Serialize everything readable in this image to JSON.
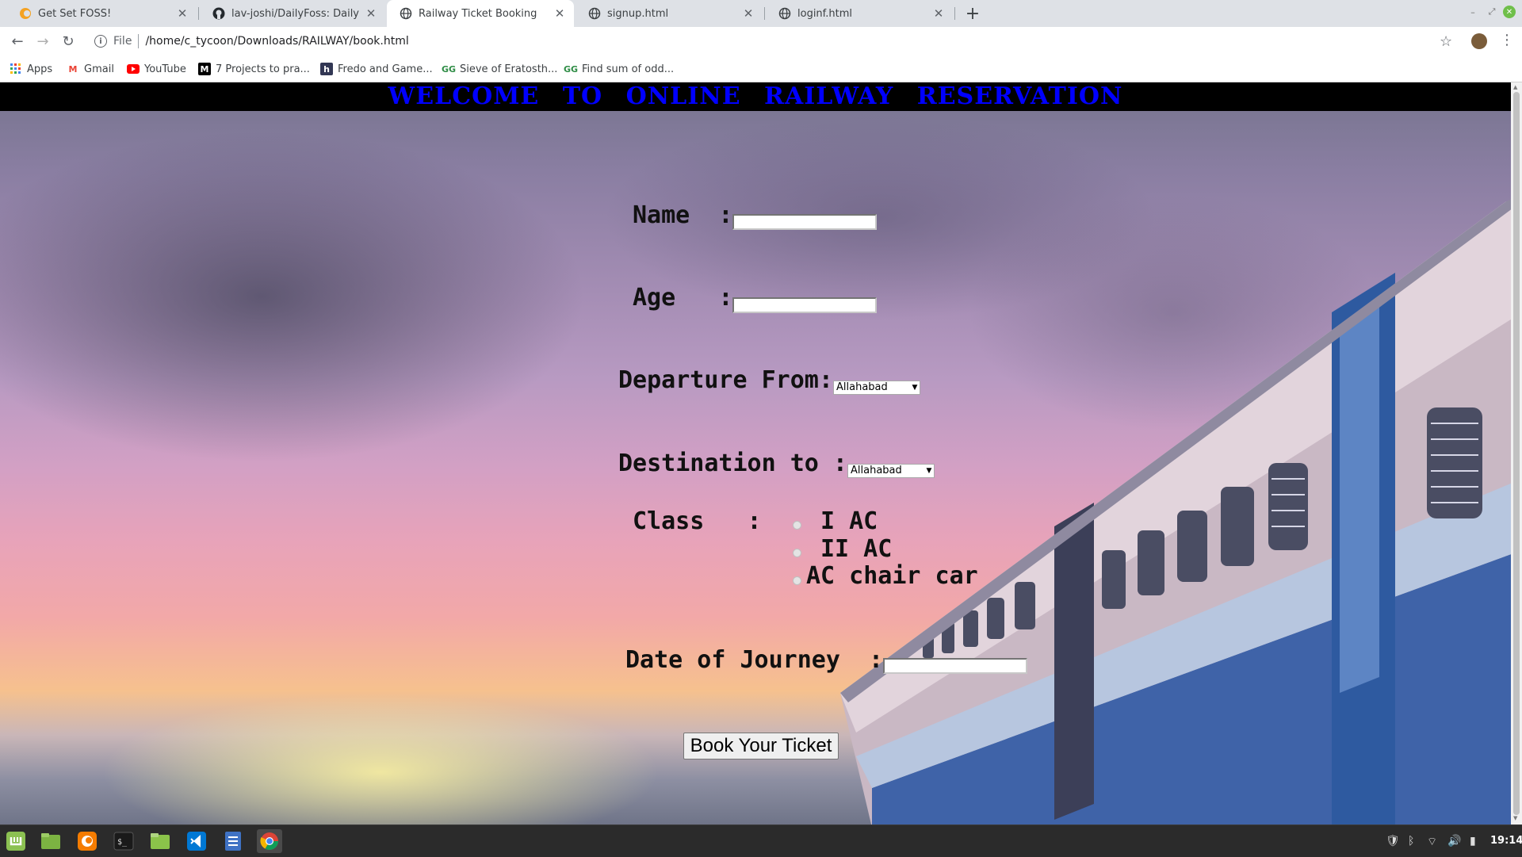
{
  "browser": {
    "tabs": [
      {
        "title": "Get Set FOSS!",
        "icon": "foss-icon"
      },
      {
        "title": "lav-joshi/DailyFoss: Daily task",
        "icon": "github-icon"
      },
      {
        "title": "Railway Ticket Booking",
        "icon": "globe-icon"
      },
      {
        "title": "signup.html",
        "icon": "globe-icon"
      },
      {
        "title": "loginf.html",
        "icon": "globe-icon"
      }
    ],
    "active_tab": 2,
    "address": {
      "scheme": "File",
      "url": "/home/c_tycoon/Downloads/RAILWAY/book.html"
    },
    "bookmarks": [
      {
        "label": "Apps",
        "icon": "apps-grid-icon"
      },
      {
        "label": "Gmail",
        "icon": "gmail-icon"
      },
      {
        "label": "YouTube",
        "icon": "youtube-icon"
      },
      {
        "label": "7 Projects to pra...",
        "icon": "medium-icon"
      },
      {
        "label": "Fredo and Game...",
        "icon": "hackerearth-icon"
      },
      {
        "label": "Sieve of Eratosth...",
        "icon": "geeksforgeeks-icon"
      },
      {
        "label": "Find sum of odd...",
        "icon": "geeksforgeeks-icon"
      }
    ]
  },
  "page": {
    "header": "WELCOME TO ONLINE RAILWAY RESERVATION",
    "form": {
      "name_label": "Name  :",
      "age_label": "Age   :",
      "departure_label": "Departure From:",
      "departure_value": "Allahabad",
      "destination_label": "Destination to :",
      "destination_value": "Allahabad",
      "class_label": "Class   :",
      "class_options": [
        "I AC",
        "II AC",
        "AC chair car"
      ],
      "date_label": "Date of Journey  :",
      "submit_label": "Book Your Ticket"
    },
    "colors": {
      "header_bg": "#000000",
      "header_text": "#0000ff"
    }
  },
  "taskbar": {
    "apps": [
      "mint-menu-icon",
      "show-desktop-icon",
      "firefox-icon",
      "terminal-icon",
      "files-icon",
      "vscode-icon",
      "text-editor-icon",
      "chrome-icon"
    ],
    "clock": "19:14"
  }
}
